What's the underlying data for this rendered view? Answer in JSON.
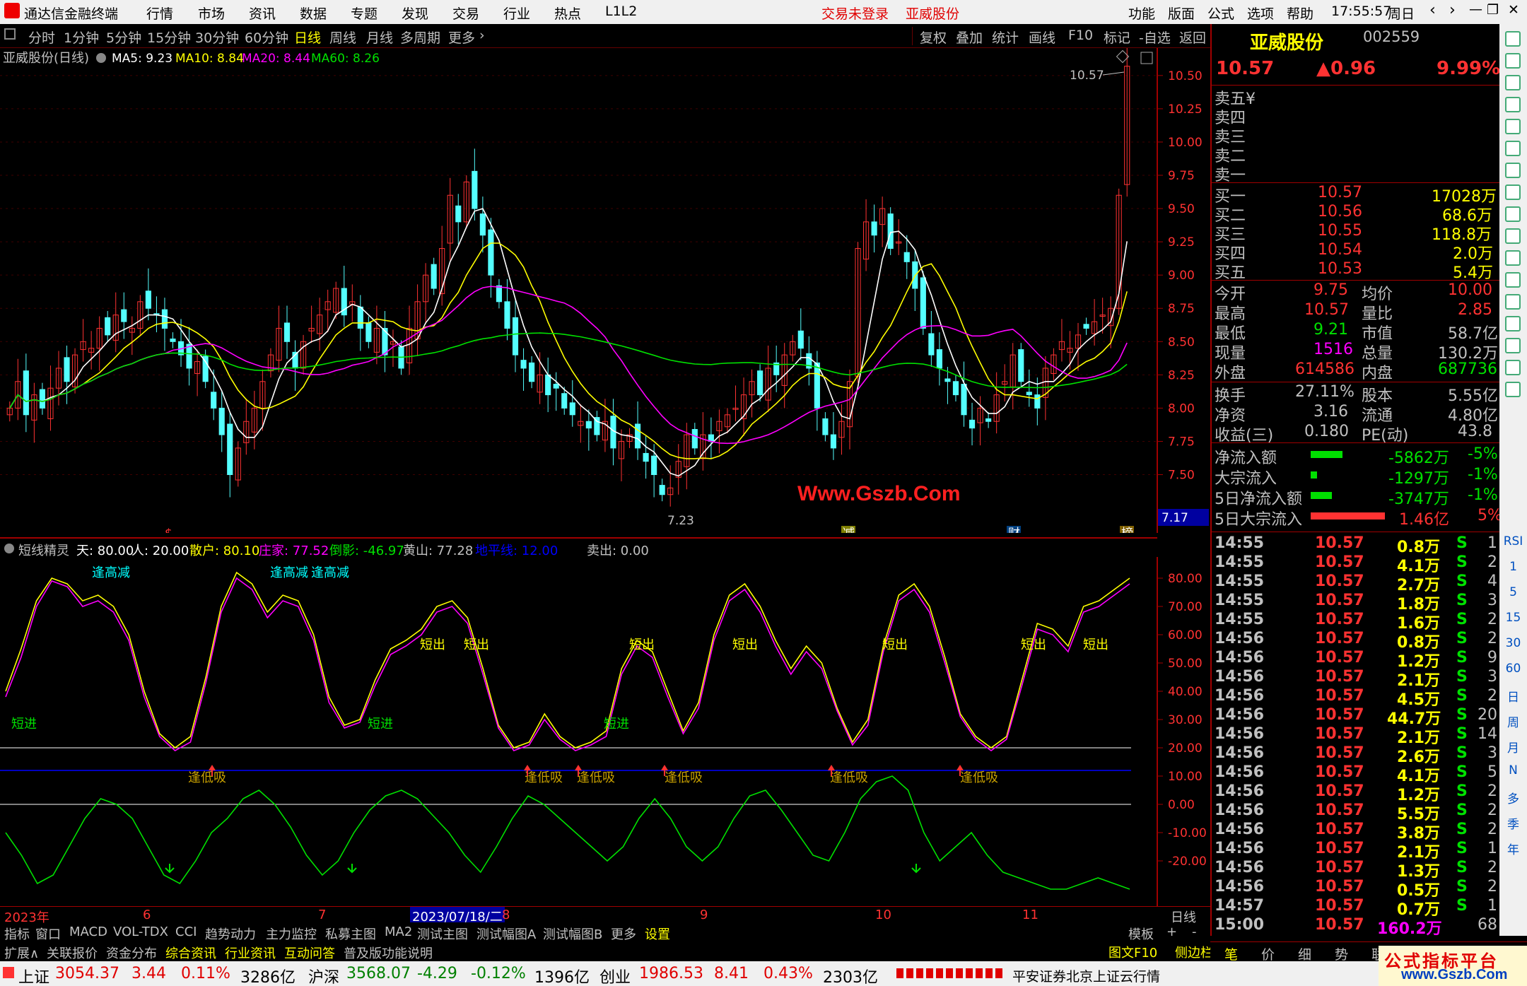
{
  "menubar": {
    "app_title": "通达信金融终端",
    "menus": [
      "行情",
      "市场",
      "资讯",
      "数据",
      "专题",
      "发现",
      "交易",
      "行业",
      "热点",
      "L1L2"
    ],
    "login_status": "交易未登录",
    "stock_name": "亚威股份",
    "right_menus": [
      "功能",
      "版面",
      "公式",
      "选项",
      "帮助"
    ],
    "clock": "17:55:57",
    "weekday": "周日"
  },
  "periodbar": {
    "periods": [
      "分时",
      "1分钟",
      "5分钟",
      "15分钟",
      "30分钟",
      "60分钟",
      "日线",
      "周线",
      "月线",
      "多周期",
      "更多"
    ],
    "selected": "日线",
    "tools": [
      "复权",
      "叠加",
      "统计",
      "画线",
      "F10",
      "标记",
      "-自选",
      "返回"
    ]
  },
  "main_chart": {
    "title": "亚威股份(日线)",
    "ma5_label": "MA5: 9.23",
    "ma10_label": "MA10: 8.84",
    "ma20_label": "MA20: 8.44",
    "ma60_label": "MA60: 8.26",
    "high_marker": "10.57",
    "low_marker": "7.23",
    "current_price_tag": "7.17",
    "event_marks": [
      "$",
      "减",
      "财",
      "榜"
    ],
    "watermark": "Www.Gszb.Com",
    "colors": {
      "up": "#ff3232",
      "down": "#54ffff",
      "ma5": "#ffffff",
      "ma10": "#ffff00",
      "ma20": "#ff00ff",
      "ma60": "#00e000"
    }
  },
  "chart_data": [
    {
      "type": "candlestick",
      "title": "亚威股份(日线)",
      "ylim": [
        7.2,
        10.6
      ],
      "yticks": [
        "10.50",
        "10.25",
        "10.00",
        "9.75",
        "9.50",
        "9.25",
        "9.00",
        "8.75",
        "8.50",
        "8.25",
        "8.00",
        "7.75",
        "7.50"
      ],
      "close": [
        8.0,
        8.2,
        7.95,
        8.1,
        8.0,
        8.15,
        8.3,
        8.2,
        8.4,
        8.5,
        8.45,
        8.6,
        8.55,
        8.7,
        8.65,
        8.6,
        8.8,
        8.75,
        8.7,
        8.6,
        8.5,
        8.4,
        8.3,
        8.35,
        8.2,
        8.0,
        7.8,
        7.5,
        7.7,
        7.9,
        8.0,
        8.2,
        8.4,
        8.6,
        8.5,
        8.3,
        8.5,
        8.6,
        8.7,
        8.8,
        8.9,
        8.7,
        8.8,
        8.6,
        8.5,
        8.6,
        8.4,
        8.5,
        8.3,
        8.6,
        8.8,
        9.0,
        8.9,
        9.2,
        9.6,
        9.4,
        9.7,
        9.5,
        9.3,
        9.0,
        8.8,
        8.6,
        8.4,
        8.3,
        8.2,
        8.25,
        8.1,
        8.15,
        8.0,
        7.95,
        7.9,
        7.85,
        7.8,
        7.9,
        7.7,
        7.75,
        7.8,
        7.7,
        7.6,
        7.5,
        7.35,
        7.4,
        7.6,
        7.8,
        7.7,
        7.8,
        7.75,
        7.9,
        7.95,
        8.0,
        8.1,
        8.2,
        8.1,
        8.3,
        8.25,
        8.4,
        8.5,
        8.45,
        8.3,
        8.0,
        7.8,
        7.7,
        7.9,
        8.2,
        9.2,
        9.4,
        9.3,
        9.5,
        9.2,
        9.25,
        9.1,
        8.9,
        8.6,
        8.4,
        8.3,
        8.2,
        8.1,
        7.95,
        7.85,
        8.0,
        7.9,
        8.1,
        8.2,
        8.4,
        8.2,
        8.1,
        8.0,
        8.3,
        8.4,
        8.5,
        8.45,
        8.55,
        8.6,
        8.65,
        8.7,
        8.75,
        9.6,
        10.57
      ],
      "ma_series": [
        "MA5",
        "MA10",
        "MA20",
        "MA60"
      ]
    },
    {
      "type": "line",
      "title": "短线精灵",
      "ylim": [
        -30,
        85
      ],
      "yticks": [
        "80.00",
        "70.00",
        "60.00",
        "50.00",
        "40.00",
        "30.00",
        "20.00",
        "10.00",
        "0.00",
        "-10.00",
        "-20.00"
      ],
      "series": [
        {
          "name": "天",
          "values": [
            40,
            55,
            72,
            80,
            78,
            72,
            74,
            70,
            60,
            40,
            25,
            20,
            24,
            45,
            70,
            82,
            78,
            68,
            74,
            72,
            60,
            38,
            28,
            30,
            44,
            55,
            58,
            62,
            70,
            72,
            66,
            48,
            28,
            20,
            22,
            32,
            24,
            20,
            22,
            26,
            48,
            58,
            54,
            40,
            26,
            36,
            60,
            74,
            78,
            70,
            58,
            48,
            56,
            50,
            34,
            22,
            30,
            56,
            74,
            78,
            70,
            52,
            32,
            24,
            20,
            24,
            44,
            64,
            62,
            56,
            70,
            72,
            76,
            80
          ]
        },
        {
          "name": "人",
          "values": [
            38,
            52,
            70,
            79,
            77,
            70,
            72,
            68,
            58,
            38,
            24,
            19,
            22,
            43,
            68,
            80,
            76,
            66,
            72,
            70,
            58,
            36,
            27,
            29,
            42,
            53,
            56,
            60,
            68,
            70,
            64,
            46,
            27,
            19,
            21,
            30,
            23,
            19,
            21,
            24,
            46,
            56,
            52,
            38,
            25,
            34,
            58,
            72,
            76,
            68,
            56,
            46,
            54,
            48,
            33,
            21,
            28,
            54,
            72,
            76,
            68,
            50,
            31,
            23,
            19,
            23,
            42,
            62,
            60,
            54,
            68,
            70,
            74,
            78
          ]
        },
        {
          "name": "庄家",
          "values": [
            -10,
            -18,
            -28,
            -25,
            -15,
            -5,
            2,
            0,
            -5,
            -15,
            -25,
            -28,
            -20,
            -10,
            -5,
            2,
            5,
            0,
            -8,
            -18,
            -25,
            -20,
            -10,
            -2,
            3,
            5,
            2,
            -4,
            -10,
            -18,
            -24,
            -15,
            -5,
            3,
            0,
            -5,
            -10,
            -15,
            -20,
            -15,
            -5,
            2,
            -5,
            -15,
            -20,
            -15,
            -5,
            3,
            5,
            -2,
            -10,
            -18,
            -20,
            -10,
            2,
            8,
            10,
            5,
            -10,
            -20,
            -15,
            -10,
            -18,
            -24,
            -26,
            -28,
            -30,
            -30,
            -28,
            -26,
            -28,
            -30
          ]
        },
        {
          "name": "地平线",
          "values": [
            12
          ]
        }
      ],
      "signal_labels": {
        "short_in": "短进",
        "short_out": "短出",
        "high_reduce": "逢高减",
        "low_buy": "逢低吸"
      }
    }
  ],
  "indicator_header": {
    "name": "短线精灵",
    "tian": "天: 80.00",
    "ren": "人: 20.00",
    "sanhu": "散户: 80.10",
    "zhuangjia": "庄家: 77.52",
    "daoying": "倒影: -46.97",
    "huangshan": "黄山: 77.28",
    "dipingxian": "地平线: 12.00",
    "maichu": "卖出: 0.00"
  },
  "date_axis": {
    "labels": [
      "2023年",
      "6",
      "7",
      "2023/07/18/二",
      "8",
      "9",
      "10",
      "11"
    ],
    "period": "日线"
  },
  "bottom_tabs": [
    "指标",
    "窗口",
    "MACD",
    "VOL-TDX",
    "CCI",
    "趋势动力",
    "主力监控",
    "私募主图",
    "MA2",
    "测试主图",
    "测试幅图A",
    "测试幅图B",
    "更多",
    "设置",
    "模板",
    "+",
    "-"
  ],
  "bottom_tabs2": [
    "扩展∧",
    "关联报价",
    "资金分布",
    "综合资讯",
    "行业资讯",
    "互动问答",
    "普及版功能说明"
  ],
  "quote_panel": {
    "name": "亚威股份",
    "code": "002559",
    "price": "10.57",
    "change": "▲0.96",
    "change_pct": "9.99%",
    "sell": [
      {
        "label": "卖五",
        "extra": "¥"
      },
      {
        "label": "卖四"
      },
      {
        "label": "卖三"
      },
      {
        "label": "卖二"
      },
      {
        "label": "卖一"
      }
    ],
    "buy": [
      {
        "label": "买一",
        "price": "10.57",
        "vol": "17028万"
      },
      {
        "label": "买二",
        "price": "10.56",
        "vol": "68.6万"
      },
      {
        "label": "买三",
        "price": "10.55",
        "vol": "118.8万"
      },
      {
        "label": "买四",
        "price": "10.54",
        "vol": "2.0万"
      },
      {
        "label": "买五",
        "price": "10.53",
        "vol": "5.4万"
      }
    ],
    "stats": [
      {
        "l1": "今开",
        "v1": "9.75",
        "l2": "均价",
        "v2": "10.00",
        "c1": "#ff3232",
        "c2": "#ff3232"
      },
      {
        "l1": "最高",
        "v1": "10.57",
        "l2": "量比",
        "v2": "2.85",
        "c1": "#ff3232",
        "c2": "#ff3232"
      },
      {
        "l1": "最低",
        "v1": "9.21",
        "l2": "市值",
        "v2": "58.7亿",
        "c1": "#00e000",
        "c2": "#c0c0c0"
      },
      {
        "l1": "现量",
        "v1": "1516",
        "l2": "总量",
        "v2": "130.2万",
        "c1": "#ff00ff",
        "c2": "#c0c0c0"
      },
      {
        "l1": "外盘",
        "v1": "614586",
        "l2": "内盘",
        "v2": "687736",
        "c1": "#ff3232",
        "c2": "#00e000"
      }
    ],
    "stats2": [
      {
        "l1": "换手",
        "v1": "27.11%",
        "l2": "股本",
        "v2": "5.55亿"
      },
      {
        "l1": "净资",
        "v1": "3.16",
        "l2": "流通",
        "v2": "4.80亿"
      },
      {
        "l1": "收益(三)",
        "v1": "0.180",
        "l2": "PE(动)",
        "v2": "43.8"
      }
    ],
    "flows": [
      {
        "label": "净流入额",
        "value": "-5862万",
        "pct": "-5%",
        "bar": 0.3,
        "color": "#00e000"
      },
      {
        "label": "大宗流入",
        "value": "-1297万",
        "pct": "-1%",
        "bar": 0.06,
        "color": "#00e000"
      },
      {
        "label": "5日净流入额",
        "value": "-3747万",
        "pct": "-1%",
        "bar": 0.2,
        "color": "#00e000"
      },
      {
        "label": "5日大宗流入",
        "value": "1.46亿",
        "pct": "5%",
        "bar": 0.7,
        "color": "#ff3232"
      }
    ],
    "ticks": [
      {
        "t": "14:55",
        "p": "10.57",
        "v": "0.8万",
        "s": "S",
        "n": "1"
      },
      {
        "t": "14:55",
        "p": "10.57",
        "v": "4.1万",
        "s": "S",
        "n": "2"
      },
      {
        "t": "14:55",
        "p": "10.57",
        "v": "2.7万",
        "s": "S",
        "n": "4"
      },
      {
        "t": "14:55",
        "p": "10.57",
        "v": "1.8万",
        "s": "S",
        "n": "3"
      },
      {
        "t": "14:55",
        "p": "10.57",
        "v": "1.6万",
        "s": "S",
        "n": "2"
      },
      {
        "t": "14:56",
        "p": "10.57",
        "v": "0.8万",
        "s": "S",
        "n": "2"
      },
      {
        "t": "14:56",
        "p": "10.57",
        "v": "1.2万",
        "s": "S",
        "n": "9"
      },
      {
        "t": "14:56",
        "p": "10.57",
        "v": "2.1万",
        "s": "S",
        "n": "3"
      },
      {
        "t": "14:56",
        "p": "10.57",
        "v": "4.5万",
        "s": "S",
        "n": "2"
      },
      {
        "t": "14:56",
        "p": "10.57",
        "v": "44.7万",
        "s": "S",
        "n": "20"
      },
      {
        "t": "14:56",
        "p": "10.57",
        "v": "2.1万",
        "s": "S",
        "n": "14"
      },
      {
        "t": "14:56",
        "p": "10.57",
        "v": "2.6万",
        "s": "S",
        "n": "3"
      },
      {
        "t": "14:56",
        "p": "10.57",
        "v": "4.1万",
        "s": "S",
        "n": "5"
      },
      {
        "t": "14:56",
        "p": "10.57",
        "v": "1.2万",
        "s": "S",
        "n": "2"
      },
      {
        "t": "14:56",
        "p": "10.57",
        "v": "5.5万",
        "s": "S",
        "n": "2"
      },
      {
        "t": "14:56",
        "p": "10.57",
        "v": "3.8万",
        "s": "S",
        "n": "2"
      },
      {
        "t": "14:56",
        "p": "10.57",
        "v": "2.1万",
        "s": "S",
        "n": "1"
      },
      {
        "t": "14:56",
        "p": "10.57",
        "v": "1.3万",
        "s": "S",
        "n": "2"
      },
      {
        "t": "14:56",
        "p": "10.57",
        "v": "0.5万",
        "s": "S",
        "n": "2"
      },
      {
        "t": "14:57",
        "p": "10.57",
        "v": "0.7万",
        "s": "S",
        "n": "1"
      },
      {
        "t": "15:00",
        "p": "10.57",
        "v": "160.2万",
        "s": "",
        "n": "68"
      }
    ],
    "ticks_right": [
      "图文F10",
      "侧边栏 «"
    ],
    "tabs": [
      "笔",
      "价",
      "细",
      "势",
      "联"
    ]
  },
  "toolbar": {
    "labels": [
      "RSI",
      "1",
      "5",
      "15",
      "30",
      "60",
      "日",
      "周",
      "月",
      "N",
      "多",
      "季",
      "年"
    ]
  },
  "status": {
    "sh_name": "上证",
    "sh_val": "3054.37",
    "sh_chg": "3.44",
    "sh_pct": "0.11%",
    "sh_amt": "3286亿",
    "sz_name": "沪深",
    "sz_val": "3568.07",
    "sz_chg": "-4.29",
    "sz_pct": "-0.12%",
    "sz_amt": "1396亿",
    "cy_name": "创业",
    "cy_val": "1986.53",
    "cy_chg": "8.41",
    "cy_pct": "0.43%",
    "cy_amt": "2303亿",
    "broker": "平安证券北京上证云行情"
  },
  "logo": {
    "line1": "公式指标平台",
    "line2": "www.Gszb.Com"
  }
}
